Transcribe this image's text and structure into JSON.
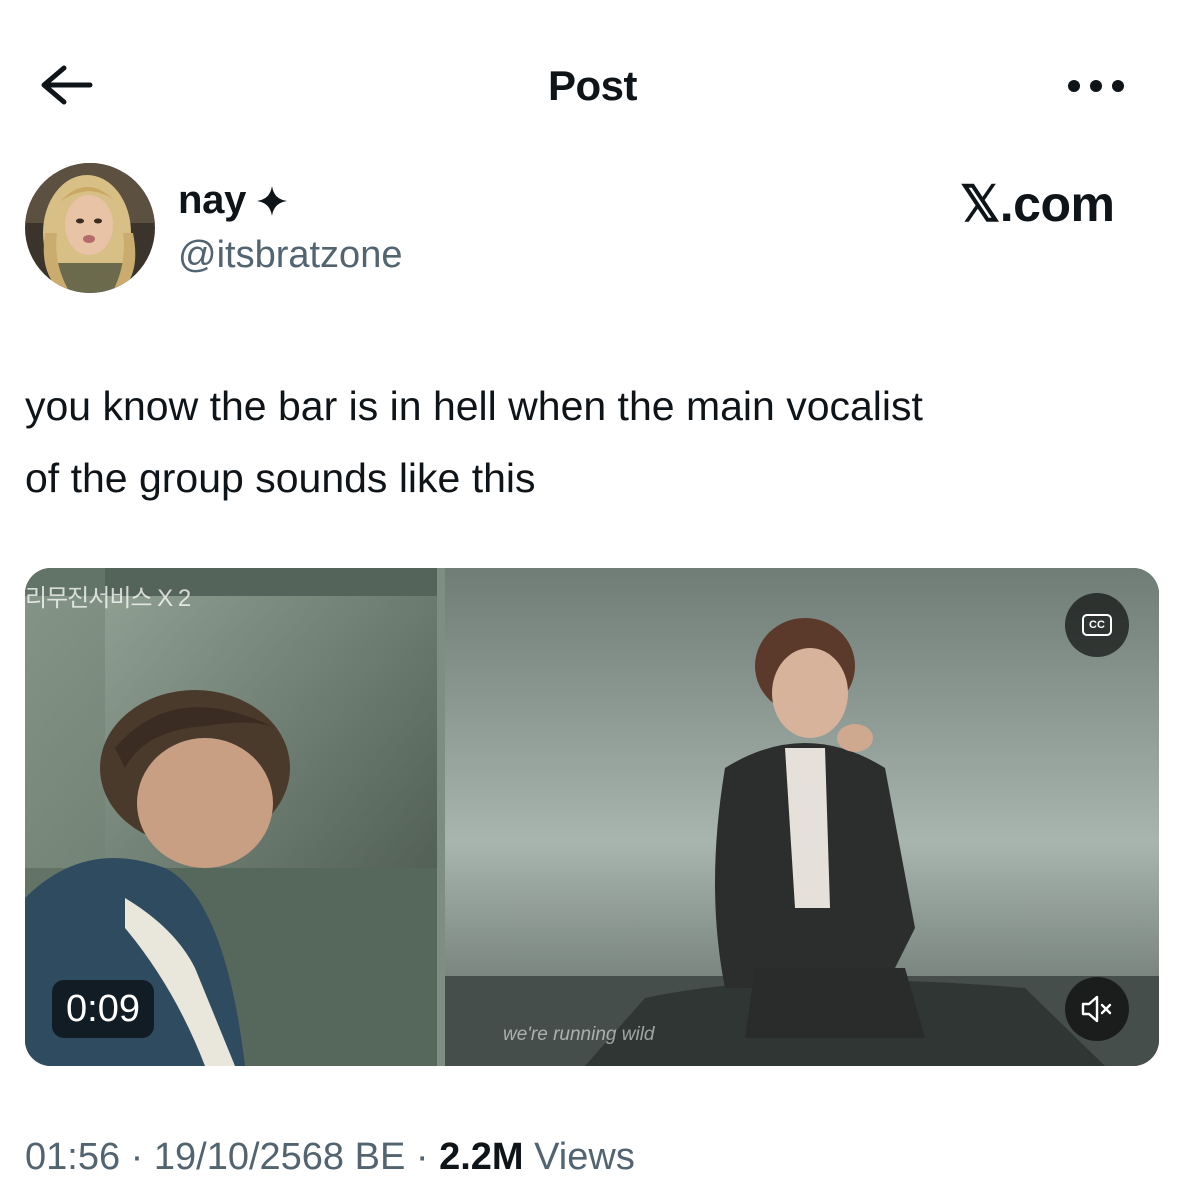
{
  "header": {
    "title": "Post",
    "back_icon": "arrow-left-icon",
    "more_icon": "more-horizontal-icon"
  },
  "author": {
    "display_name": "nay",
    "badge_icon": "sparkle-star-icon",
    "handle": "@itsbratzone"
  },
  "watermark": "𝕏.com",
  "post": {
    "text_line1": "you know the bar is in hell when the main vocalist",
    "text_line2": "of the group sounds like this"
  },
  "video": {
    "duration": "0:09",
    "cc_label": "CC",
    "subtitle": "we're running wild",
    "logo_text": "리무진서비스 X 2",
    "mute_icon": "volume-muted-icon"
  },
  "meta": {
    "time": "01:56",
    "separator": " · ",
    "date": "19/10/2568 BE",
    "views_count": "2.2M",
    "views_label": "Views"
  },
  "colors": {
    "text_primary": "#0f1419",
    "text_secondary": "#536471",
    "background": "#ffffff"
  }
}
